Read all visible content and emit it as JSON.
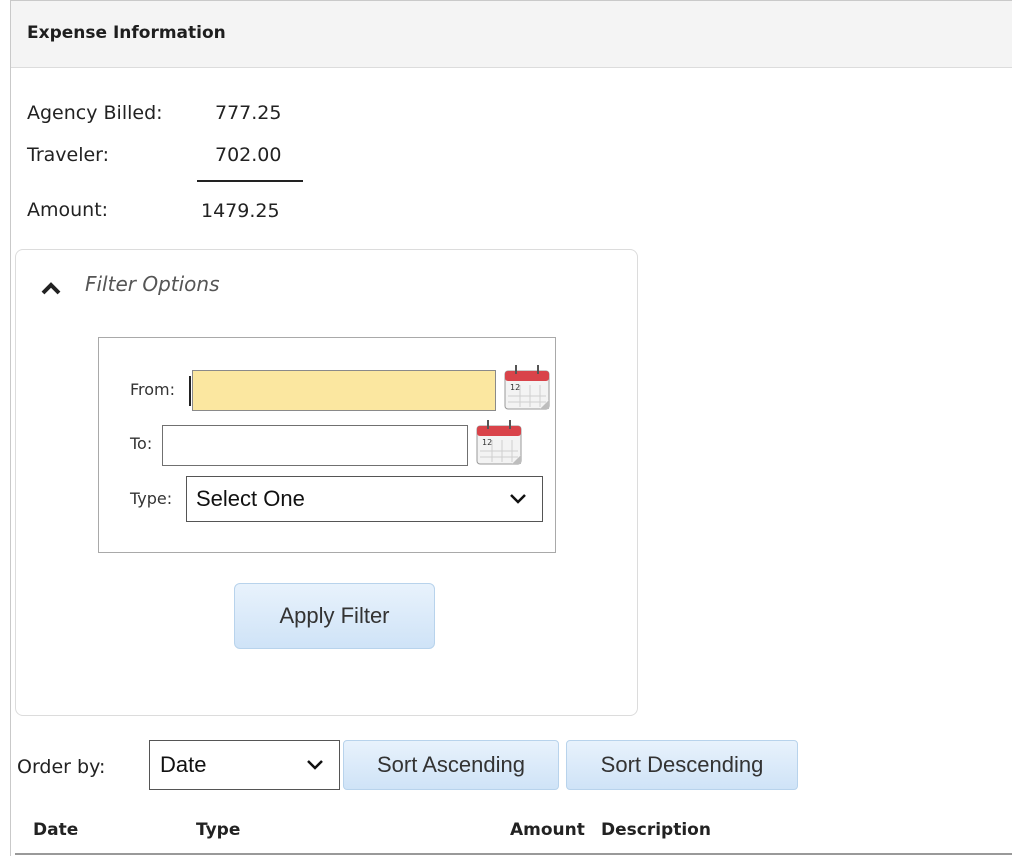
{
  "panel": {
    "title": "Expense Information"
  },
  "summary": {
    "agency_billed_label": "Agency Billed:",
    "agency_billed_value": "777.25",
    "traveler_label": "Traveler:",
    "traveler_value": "702.00",
    "amount_label": "Amount:",
    "amount_value": "1479.25"
  },
  "filter": {
    "toggle_icon": "chevron-up-icon",
    "title": "Filter Options",
    "from_label": "From:",
    "from_value": "",
    "to_label": "To:",
    "to_value": "",
    "calendar_icon": "calendar-icon",
    "calendar_day": "12",
    "type_label": "Type:",
    "type_selected": "Select One",
    "apply_label": "Apply Filter"
  },
  "order": {
    "label": "Order by:",
    "selected": "Date",
    "sort_ascending": "Sort Ascending",
    "sort_descending": "Sort Descending"
  },
  "table": {
    "columns": [
      "Date",
      "Type",
      "Amount",
      "Description"
    ]
  },
  "colors": {
    "focused_input": "#fbe7a0",
    "button_bg": "#cfe3f7",
    "calendar_red": "#d9434a"
  }
}
